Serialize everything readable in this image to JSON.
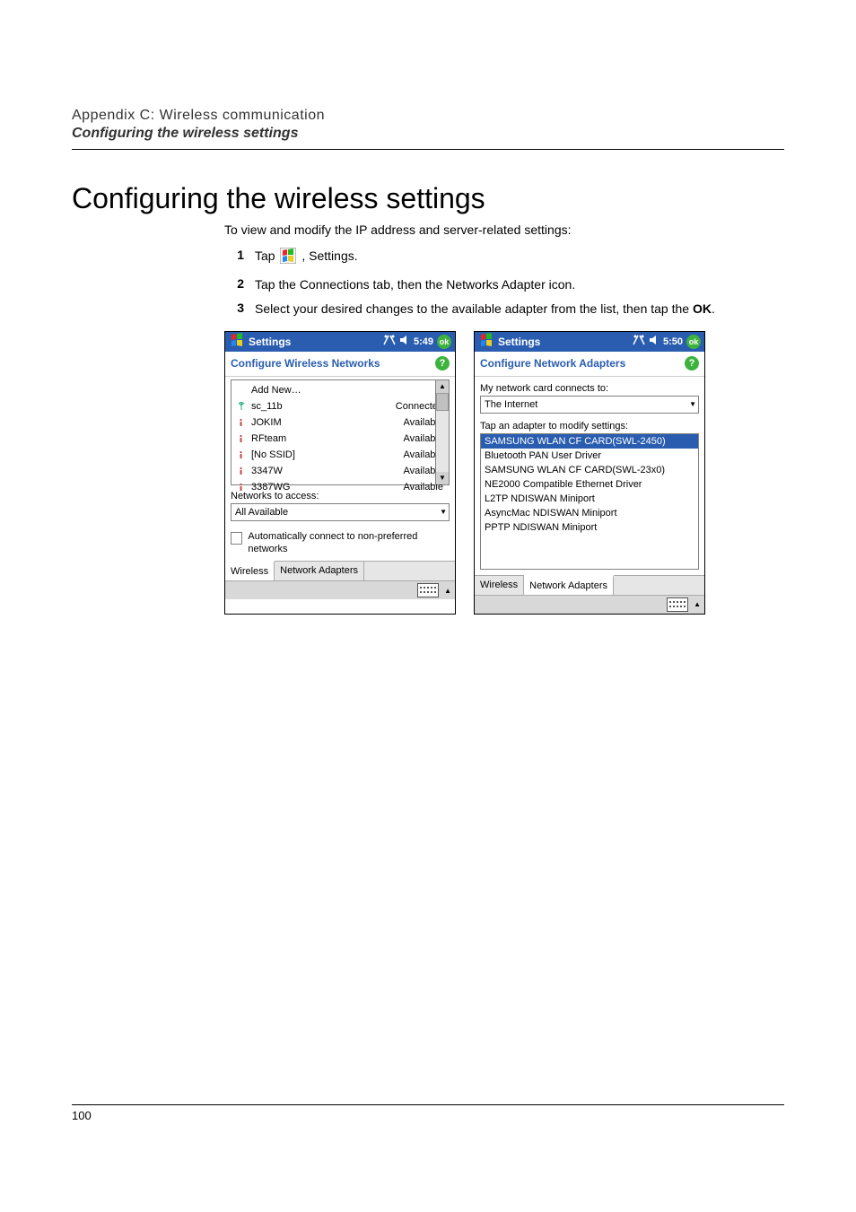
{
  "header": {
    "section": "Appendix C: Wireless communication",
    "subsection": "Configuring the wireless settings"
  },
  "title": "Configuring the wireless settings",
  "intro": "To view and modify the IP address and server-related settings:",
  "steps": [
    {
      "num": "1",
      "before": "Tap ",
      "after": " , Settings."
    },
    {
      "num": "2",
      "text": "Tap the Connections tab, then the Networks Adapter icon."
    },
    {
      "num": "3",
      "text_before": "Select your desired changes to the available adapter from the list, then tap the ",
      "bold": "OK",
      "text_after": "."
    }
  ],
  "left_screen": {
    "titlebar": {
      "title": "Settings",
      "time": "5:49",
      "ok": "ok"
    },
    "subtitle": "Configure Wireless Networks",
    "rows": [
      {
        "name": "Add New…",
        "status": "",
        "icon": "none"
      },
      {
        "name": "sc_11b",
        "status": "Connected",
        "icon": "antenna"
      },
      {
        "name": "JOKIM",
        "status": "Available",
        "icon": "info"
      },
      {
        "name": "RFteam",
        "status": "Available",
        "icon": "info"
      },
      {
        "name": "[No SSID]",
        "status": "Available",
        "icon": "info"
      },
      {
        "name": "3347W",
        "status": "Available",
        "icon": "info"
      },
      {
        "name": "3387WG",
        "status": "Available",
        "icon": "info"
      }
    ],
    "access_label": "Networks to access:",
    "access_value": "All Available",
    "checkbox_label": "Automatically connect to non-preferred networks",
    "tabs": {
      "wireless": "Wireless",
      "adapters": "Network Adapters"
    }
  },
  "right_screen": {
    "titlebar": {
      "title": "Settings",
      "time": "5:50",
      "ok": "ok"
    },
    "subtitle": "Configure Network Adapters",
    "connects_label": "My network card connects to:",
    "connects_value": "The Internet",
    "tap_label": "Tap an adapter to modify settings:",
    "adapters": [
      "SAMSUNG WLAN CF CARD(SWL-2450)",
      "Bluetooth PAN User Driver",
      "SAMSUNG WLAN CF CARD(SWL-23x0)",
      "NE2000 Compatible Ethernet Driver",
      "L2TP NDISWAN Miniport",
      "AsyncMac NDISWAN Miniport",
      "PPTP NDISWAN Miniport"
    ],
    "selected_index": 0,
    "tabs": {
      "wireless": "Wireless",
      "adapters": "Network Adapters"
    }
  },
  "page_number": "100"
}
